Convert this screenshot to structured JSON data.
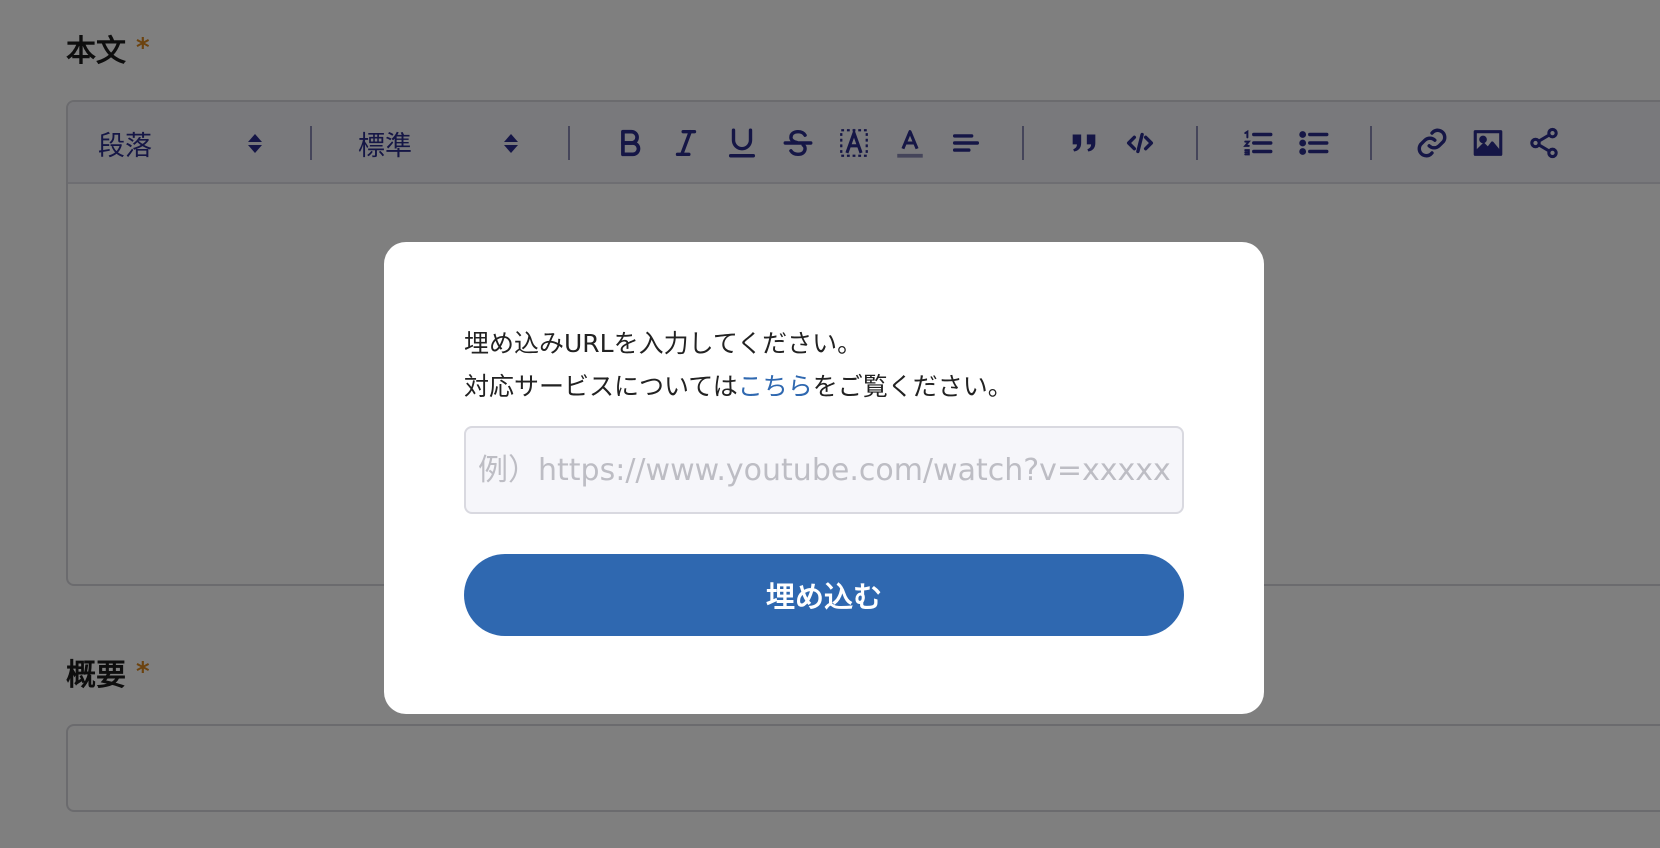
{
  "form": {
    "body_label": "本文",
    "summary_label": "概要",
    "required_mark": "*"
  },
  "toolbar": {
    "paragraph_select": "段落",
    "size_select": "標準",
    "buttons": [
      "bold-icon",
      "italic-icon",
      "underline-icon",
      "strikethrough-icon",
      "highlight-icon",
      "text-color-icon",
      "align-left-icon",
      "blockquote-icon",
      "code-icon",
      "ordered-list-icon",
      "bullet-list-icon",
      "link-icon",
      "image-icon",
      "share-embed-icon"
    ]
  },
  "modal": {
    "line1": "埋め込みURLを入力してください。",
    "line2_before": "対応サービスについては",
    "line2_link": "こちら",
    "line2_after": "をご覧ください。",
    "input_placeholder": "例）https://www.youtube.com/watch?v=xxxxxxx",
    "input_value": "",
    "submit_label": "埋め込む"
  },
  "colors": {
    "accent": "#2f68b0",
    "toolbar_icon": "#2b2c8c",
    "required": "#d9861e",
    "overlay": "rgba(0,0,0,0.5)"
  }
}
